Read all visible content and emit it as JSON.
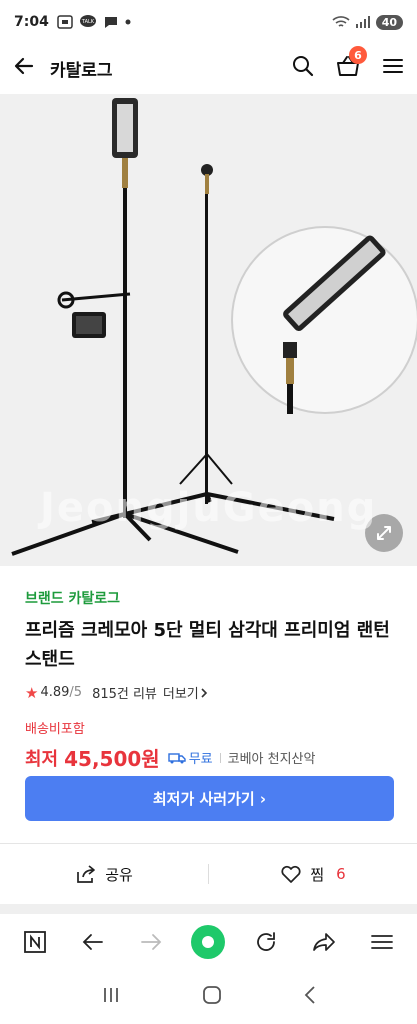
{
  "status_bar": {
    "time": "7:04",
    "battery": "40"
  },
  "app_bar": {
    "title": "카탈로그",
    "cart_count": "6"
  },
  "image": {
    "watermark": "JeongjuGeong"
  },
  "product": {
    "brand_link": "브랜드 카탈로그",
    "name": "프리즘 크레모아 5단 멀티 삼각대 프리미엄 랜턴스탠드",
    "rating": "4.89",
    "rating_max": "/5",
    "review_count": "815건 리뷰",
    "more_label": "더보기",
    "free_shipping_label": "배송비포함",
    "price_prefix": "최저",
    "price": "45,500원",
    "shipping_text": "무료",
    "seller": "코베아 천지산악"
  },
  "cta": {
    "label": "최저가 사러가기 ›"
  },
  "actions": {
    "share_label": "공유",
    "wish_label": "찜",
    "wish_count": "6"
  },
  "colors": {
    "brand_green": "#1d9b3c",
    "price_red": "#e8343c",
    "cta_blue": "#4c7ef2",
    "home_green": "#1ec96a"
  },
  "icons": [
    "back-arrow-icon",
    "search-icon",
    "cart-icon",
    "menu-icon",
    "expand-icon",
    "star-icon",
    "truck-icon",
    "share-icon",
    "heart-icon",
    "naver-n-icon",
    "forward-arrow-icon",
    "refresh-icon",
    "share-arrow-icon",
    "recent-apps-icon",
    "home-icon"
  ]
}
